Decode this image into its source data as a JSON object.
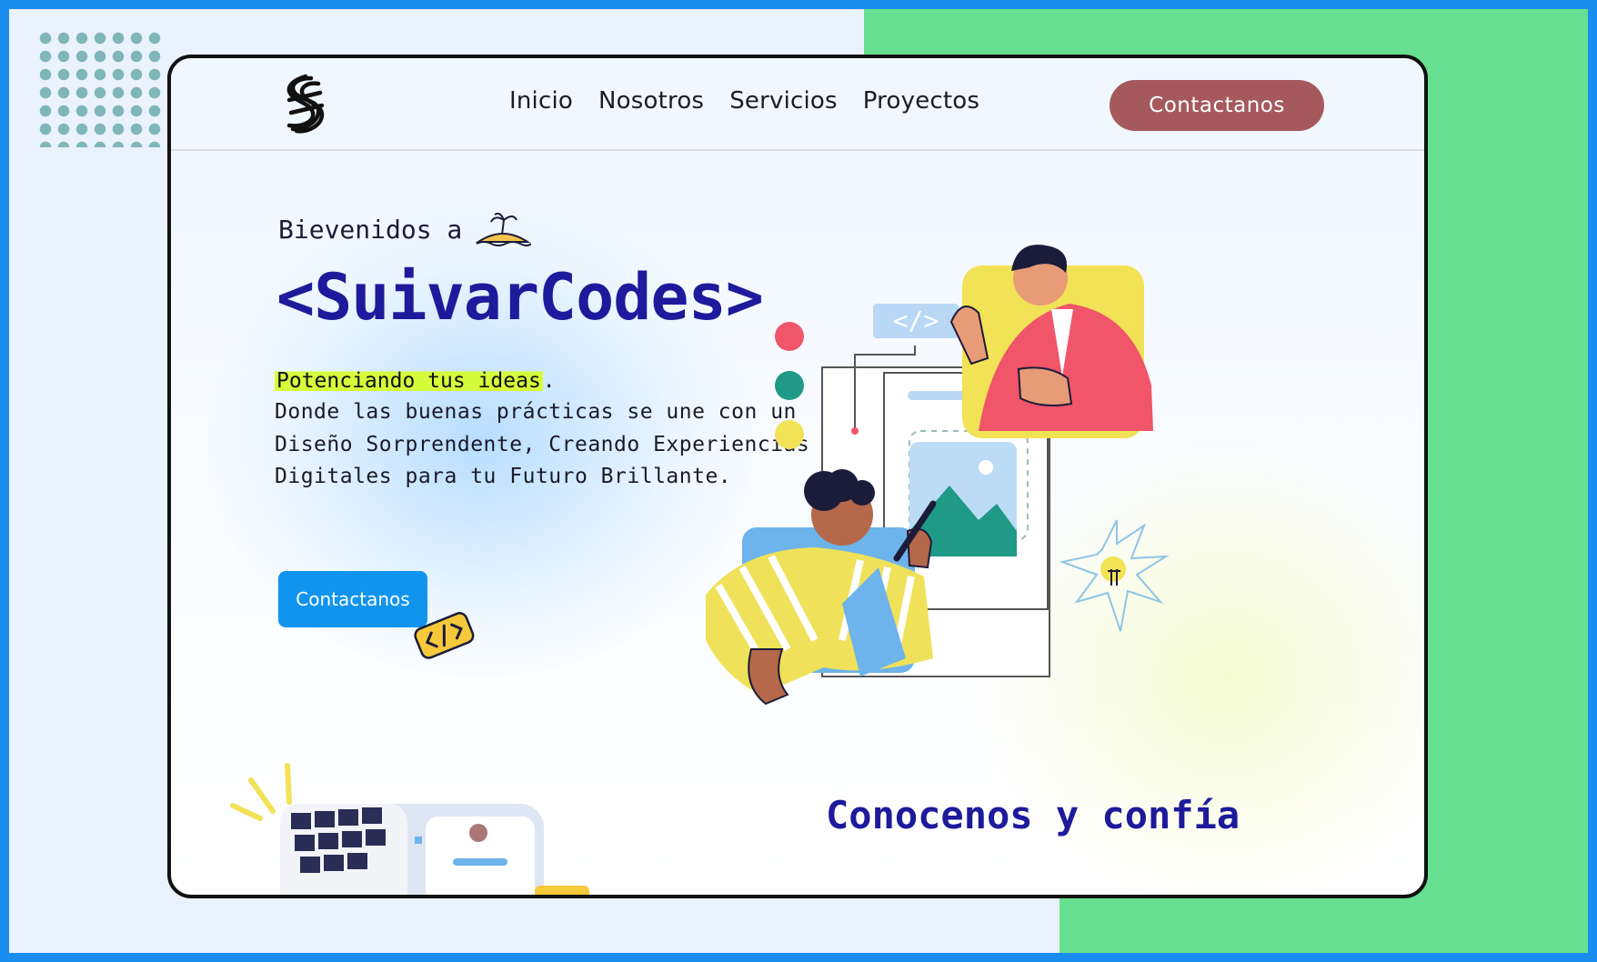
{
  "nav": {
    "links": [
      "Inicio",
      "Nosotros",
      "Servicios",
      "Proyectos"
    ],
    "cta": "Contactanos"
  },
  "hero": {
    "welcome": "Bievenidos a",
    "brand": "<SuivarCodes>",
    "highlight": "Potenciando tus ideas",
    "highlight_end": ".",
    "description": "Donde las buenas prácticas se une con un Diseño Sorprendente, Creando Experiencias Digitales para tu Futuro Brillante.",
    "cta": "Contactanos"
  },
  "about": {
    "title": "Conocenos y confía"
  },
  "colors": {
    "accent_brand": "#1d1a9c",
    "nav_cta": "#a6595c",
    "hero_cta": "#1194ee",
    "highlight": "#d6fb3a",
    "outer_border": "#1a8cf0",
    "green_panel": "#66e090"
  },
  "icons": [
    "logo-icon",
    "island-icon",
    "code-tag-icon",
    "lightbulb-icon"
  ]
}
